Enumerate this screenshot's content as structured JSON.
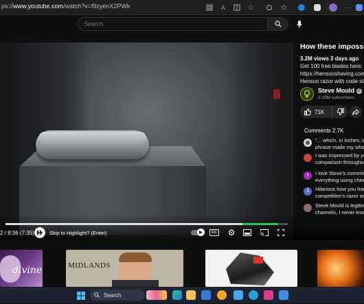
{
  "browser": {
    "url_prefix": "ps://",
    "url_host": "www.youtube.com",
    "url_path": "/watch?v=f9zyenX2PWk"
  },
  "header": {
    "search_placeholder": "Search"
  },
  "player": {
    "timecode": "2 / 9:36 (7:35)",
    "skip_label": "Skip to Highlight? (Enter)",
    "progress_played": 0.965,
    "progress_segment": 0.84,
    "cc_label": "CC"
  },
  "video": {
    "title": "How these impossibly",
    "views_date": "3.2M views  3 days ago",
    "desc_line1": "Get 100 free blades here:",
    "desc_line2": "https://hensonshaving.com/s",
    "desc_line3": "Henson razor with code steve"
  },
  "channel": {
    "name": "Steve Mould",
    "subscribers": "2.19M subscribers"
  },
  "actions": {
    "likes": "71K"
  },
  "comments": {
    "count_label": "Comments 2.7K",
    "items": [
      {
        "line1": "\"... which, in inches, is...",
        "line2": "phrase made my whole",
        "avatar_color": "#d7d7d7",
        "avatar_letter": ""
      },
      {
        "line1": "I was impressed by yo",
        "line2": "comparison throughout",
        "avatar_color": "#c2453d",
        "avatar_letter": ""
      },
      {
        "line1": "I love Steve's commitm",
        "line2": "everything using chee",
        "avatar_color": "#9c2fb0",
        "avatar_letter": "I"
      },
      {
        "line1": "Hilarious how you had",
        "line2": "competition's razor as",
        "avatar_color": "#5c6bc0",
        "avatar_letter": "J"
      },
      {
        "line1": "Steve Mould is legitim",
        "line2": "channels, I never know",
        "avatar_color": "#8d6e63",
        "avatar_letter": ""
      }
    ]
  },
  "thumbnails": [
    {
      "label": "divine",
      "type": "purple"
    },
    {
      "label": "MIDLANDS",
      "type": "midlands"
    },
    {
      "label": "",
      "type": "metal"
    },
    {
      "label": "",
      "type": "fire"
    }
  ],
  "taskbar": {
    "search_label": "Search"
  },
  "colors": {
    "accent_green": "#22c55e",
    "channel_avatar": "#7ea62e"
  }
}
